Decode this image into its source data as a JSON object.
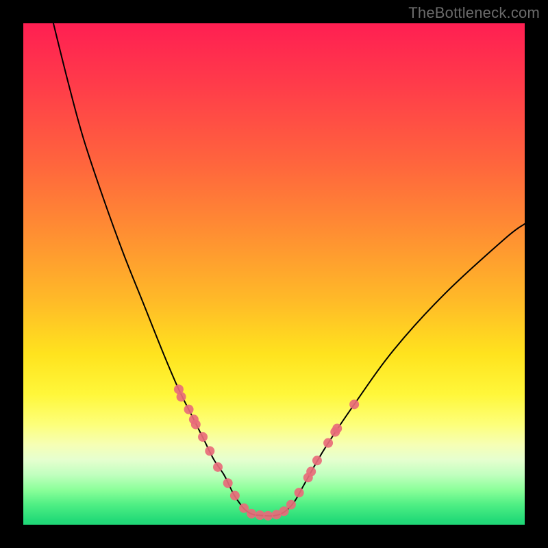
{
  "watermark": "TheBottleneck.com",
  "chart_data": {
    "type": "line",
    "title": "",
    "xlabel": "",
    "ylabel": "",
    "xlim": [
      0,
      100
    ],
    "ylim": [
      0,
      100
    ],
    "series": [
      {
        "name": "curve",
        "x": [
          6,
          9,
          12,
          16,
          20,
          24,
          28,
          31,
          34,
          36,
          38,
          40,
          41,
          42,
          43,
          44,
          45,
          46,
          48,
          50,
          52,
          54,
          56,
          60,
          66,
          74,
          84,
          96,
          100
        ],
        "y": [
          100,
          88,
          77,
          65,
          54,
          44,
          34,
          27,
          21,
          17,
          13,
          10,
          8,
          6,
          4.5,
          3.2,
          2.4,
          2.0,
          1.8,
          1.8,
          2.5,
          4.5,
          8,
          15,
          24,
          35,
          46,
          57,
          60
        ]
      }
    ],
    "markers": {
      "color": "#e86b79",
      "radius_px": 7,
      "points": [
        {
          "x": 31.0,
          "y": 27.0
        },
        {
          "x": 31.5,
          "y": 25.5
        },
        {
          "x": 33.0,
          "y": 23.0
        },
        {
          "x": 34.0,
          "y": 21.0
        },
        {
          "x": 34.4,
          "y": 20.0
        },
        {
          "x": 35.8,
          "y": 17.5
        },
        {
          "x": 37.2,
          "y": 14.7
        },
        {
          "x": 38.8,
          "y": 11.5
        },
        {
          "x": 40.8,
          "y": 8.3
        },
        {
          "x": 42.2,
          "y": 5.8
        },
        {
          "x": 44.0,
          "y": 3.3
        },
        {
          "x": 45.5,
          "y": 2.2
        },
        {
          "x": 47.2,
          "y": 1.9
        },
        {
          "x": 48.8,
          "y": 1.8
        },
        {
          "x": 50.5,
          "y": 2.0
        },
        {
          "x": 52.0,
          "y": 2.7
        },
        {
          "x": 53.4,
          "y": 4.0
        },
        {
          "x": 55.0,
          "y": 6.4
        },
        {
          "x": 56.8,
          "y": 9.4
        },
        {
          "x": 57.4,
          "y": 10.6
        },
        {
          "x": 58.6,
          "y": 12.8
        },
        {
          "x": 60.8,
          "y": 16.3
        },
        {
          "x": 62.2,
          "y": 18.5
        },
        {
          "x": 62.6,
          "y": 19.2
        },
        {
          "x": 66.0,
          "y": 24.0
        }
      ]
    },
    "gradient_stops": [
      {
        "pos": 0.0,
        "color": "#ff1f52"
      },
      {
        "pos": 0.28,
        "color": "#ff653d"
      },
      {
        "pos": 0.55,
        "color": "#ffb928"
      },
      {
        "pos": 0.74,
        "color": "#fff73a"
      },
      {
        "pos": 0.86,
        "color": "#eaffc8"
      },
      {
        "pos": 1.0,
        "color": "#20d777"
      }
    ]
  }
}
